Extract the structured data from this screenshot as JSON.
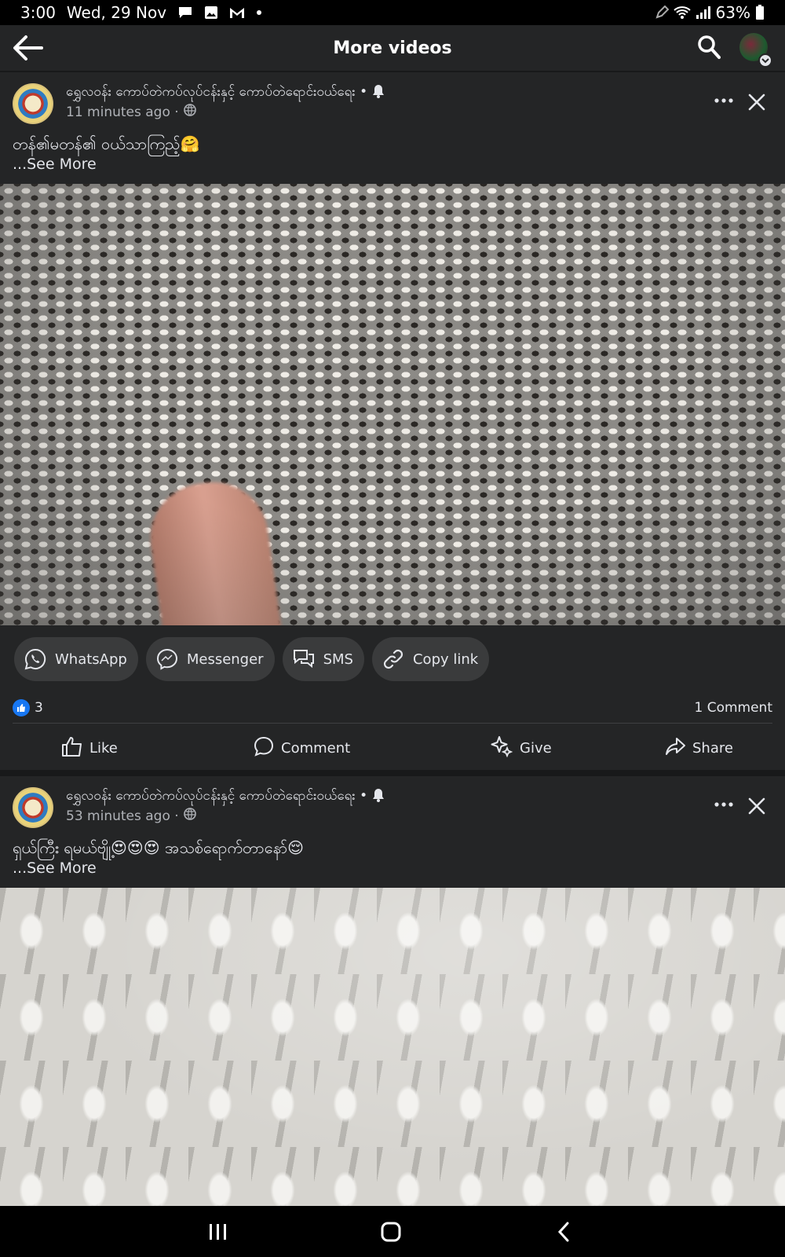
{
  "status_bar": {
    "time": "3:00",
    "date": "Wed, 29 Nov",
    "battery": "63%",
    "icons_left": [
      "chat-icon",
      "image-icon",
      "gmail-icon",
      "dot-icon"
    ],
    "icons_right": [
      "pen-icon",
      "wifi-icon",
      "signal-icon",
      "battery-icon"
    ]
  },
  "top_bar": {
    "title": "More videos",
    "back_icon": "back-arrow-icon",
    "search_icon": "search-icon"
  },
  "posts": [
    {
      "page_name": "ရွှေလဝန်း ကောပ်တဲကပ်လုပ်ငန်းနှင့် ကောပ်တဲရောင်းဝယ်ရေး •",
      "time": "11 minutes ago ·",
      "caption": "တန်၏မတန်၏ ဝယ်သာကြည့်🤗",
      "see_more": "...See More"
    },
    {
      "page_name": "ရွှေလဝန်း ကောပ်တဲကပ်လုပ်ငန်းနှင့် ကောပ်တဲရောင်းဝယ်ရေး •",
      "time": "53 minutes ago ·",
      "caption": "ရှယ်ကြီး ရမယ်ဗျို့😍😍😍 အသစ်ရောက်တာနော်😌",
      "see_more": "...See More"
    }
  ],
  "share_options": [
    {
      "label": "WhatsApp",
      "icon": "whatsapp-icon"
    },
    {
      "label": "Messenger",
      "icon": "messenger-icon"
    },
    {
      "label": "SMS",
      "icon": "sms-icon"
    },
    {
      "label": "Copy link",
      "icon": "link-icon"
    }
  ],
  "reactions": {
    "like_count": "3",
    "comments": "1 Comment"
  },
  "actions": {
    "like": "Like",
    "comment": "Comment",
    "give": "Give",
    "share": "Share"
  },
  "colors": {
    "background": "#242526",
    "chip": "#3a3b3c",
    "accent": "#1877f2",
    "text": "#e4e6eb",
    "secondary_text": "#b0b3b8"
  }
}
